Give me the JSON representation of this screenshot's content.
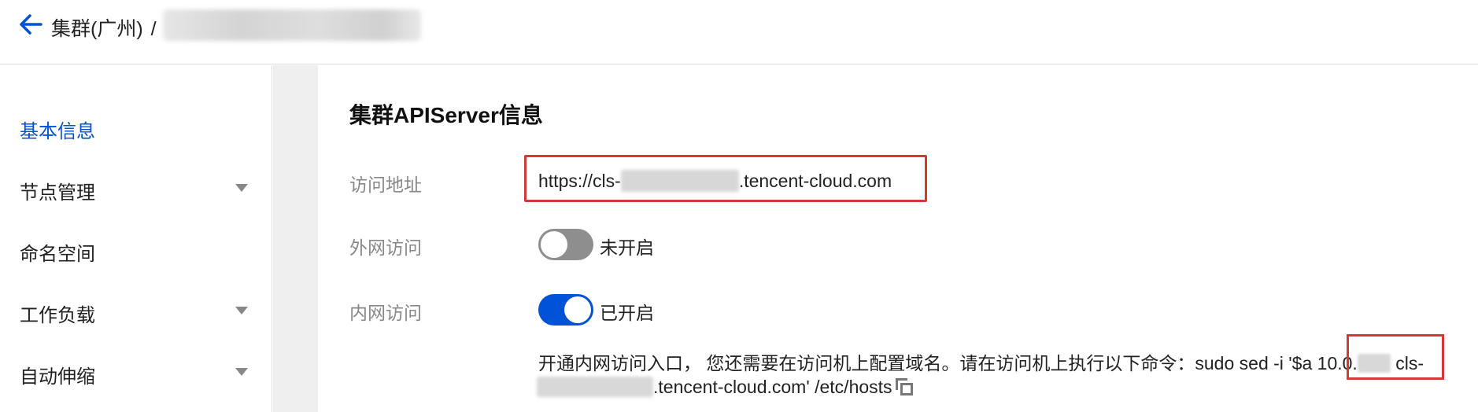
{
  "header": {
    "back_icon": "arrow-left-icon",
    "breadcrumb_cluster": "集群(广州)",
    "breadcrumb_separator": "/"
  },
  "sidebar": {
    "items": [
      {
        "label": "基本信息",
        "active": true,
        "expandable": false
      },
      {
        "label": "节点管理",
        "active": false,
        "expandable": true
      },
      {
        "label": "命名空间",
        "active": false,
        "expandable": false
      },
      {
        "label": "工作负载",
        "active": false,
        "expandable": true
      },
      {
        "label": "自动伸缩",
        "active": false,
        "expandable": true
      }
    ]
  },
  "main": {
    "section_title": "集群APIServer信息",
    "access_address": {
      "label": "访问地址",
      "url_prefix": "https://cls-",
      "url_suffix": ".tencent-cloud.com"
    },
    "public_access": {
      "label": "外网访问",
      "enabled": false,
      "status": "未开启"
    },
    "private_access": {
      "label": "内网访问",
      "enabled": true,
      "status": "已开启"
    },
    "hint": {
      "line1_prefix": "开通内网访问入口， 您还需要在访问机上配置域名。请在访问机上执行以下命令：sudo sed -i '$a ",
      "ip_prefix": "10.0.",
      "line1_suffix": " cls-",
      "line2_suffix": ".tencent-cloud.com' /etc/hosts",
      "copy_icon": "copy-icon"
    }
  },
  "colors": {
    "accent": "#0052d9",
    "highlight_border": "#d33a34",
    "toggle_off": "#8e8e8e"
  }
}
